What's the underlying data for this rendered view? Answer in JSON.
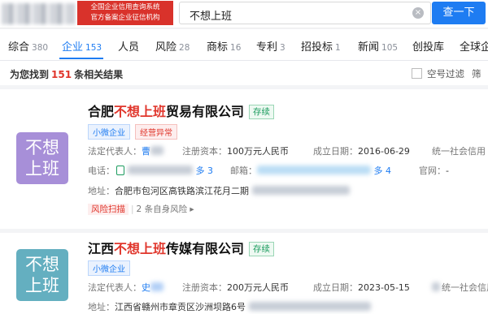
{
  "header": {
    "gov_badge_line1": "全国企业信用查询系统",
    "gov_badge_line2": "官方备案企业征信机构",
    "search_value": "不想上班",
    "clear_icon": "×",
    "search_button": "查一下"
  },
  "tabs": [
    {
      "label": "综合",
      "count": "380"
    },
    {
      "label": "企业",
      "count": "153"
    },
    {
      "label": "人员",
      "count": ""
    },
    {
      "label": "风险",
      "count": "28"
    },
    {
      "label": "商标",
      "count": "16"
    },
    {
      "label": "专利",
      "count": "3"
    },
    {
      "label": "招投标",
      "count": "1"
    },
    {
      "label": "新闻",
      "count": "105"
    },
    {
      "label": "创投库",
      "count": ""
    },
    {
      "label": "全球企",
      "count": ""
    }
  ],
  "result": {
    "prefix": "为您找到",
    "count": "151",
    "suffix": "条相关结果",
    "filter_empty": "空号过滤",
    "filter_right": "筛"
  },
  "companies": [
    {
      "logo_line1": "不想",
      "logo_line2": "上班",
      "name_prefix": "合肥",
      "name_highlight": "不想上班",
      "name_suffix": "贸易有限公司",
      "status": "存续",
      "tags": [
        "小微企业",
        "经营异常"
      ],
      "legal_rep_label": "法定代表人：",
      "legal_rep_value": "曹",
      "capital_label": "注册资本：",
      "capital_value": "100万元人民币",
      "founded_label": "成立日期：",
      "founded_value": "2016-06-29",
      "credit_label": "统一社会信用",
      "phone_label": "电话：",
      "phone_more": "多 3",
      "email_label": "邮箱：",
      "email_more": "多 4",
      "website_label": "官网：",
      "website_value": "-",
      "address_label": "地址：",
      "address_value": "合肥市包河区高铁路滨江花月二期",
      "risk_scan": "风险扫描",
      "risk_count": "2 条自身风险 ▸"
    },
    {
      "logo_line1": "不想",
      "logo_line2": "上班",
      "name_prefix": "江西",
      "name_highlight": "不想上班",
      "name_suffix": "传媒有限公司",
      "status": "存续",
      "tags": [
        "小微企业"
      ],
      "legal_rep_label": "法定代表人：",
      "legal_rep_value": "史",
      "capital_label": "注册资本：",
      "capital_value": "200万元人民币",
      "founded_label": "成立日期：",
      "founded_value": "2023-05-15",
      "credit_label": "统一社会信用",
      "address_label": "地址：",
      "address_value": "江西省赣州市章贡区沙洲坝路6号"
    }
  ],
  "colors": {
    "brand_blue": "#1e7cf2",
    "highlight_red": "#e0352b",
    "status_green": "#1a9b5d",
    "logo1": "#a78fd8",
    "logo2": "#64afc0"
  }
}
